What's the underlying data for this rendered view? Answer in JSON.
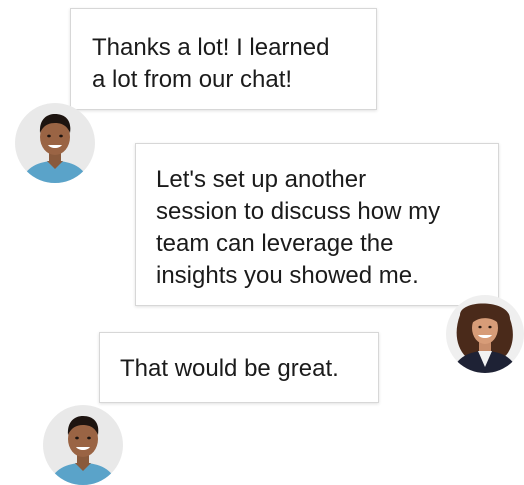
{
  "messages": [
    {
      "sender": "man",
      "lines": [
        "Thanks a lot! I learned",
        "a lot from our chat!"
      ]
    },
    {
      "sender": "woman",
      "lines": [
        "Let's set up another",
        "session to discuss how my",
        "team can leverage the",
        "insights you showed me."
      ]
    },
    {
      "sender": "man",
      "lines": [
        "That would be great."
      ]
    }
  ],
  "avatars": {
    "man": {
      "icon": "young-man-avatar",
      "shirt_color": "#5aa3c9",
      "bg_color": "#e9e9e9"
    },
    "woman": {
      "icon": "smiling-woman-avatar",
      "jacket_color": "#1e2235",
      "bg_color": "#efefef"
    }
  }
}
